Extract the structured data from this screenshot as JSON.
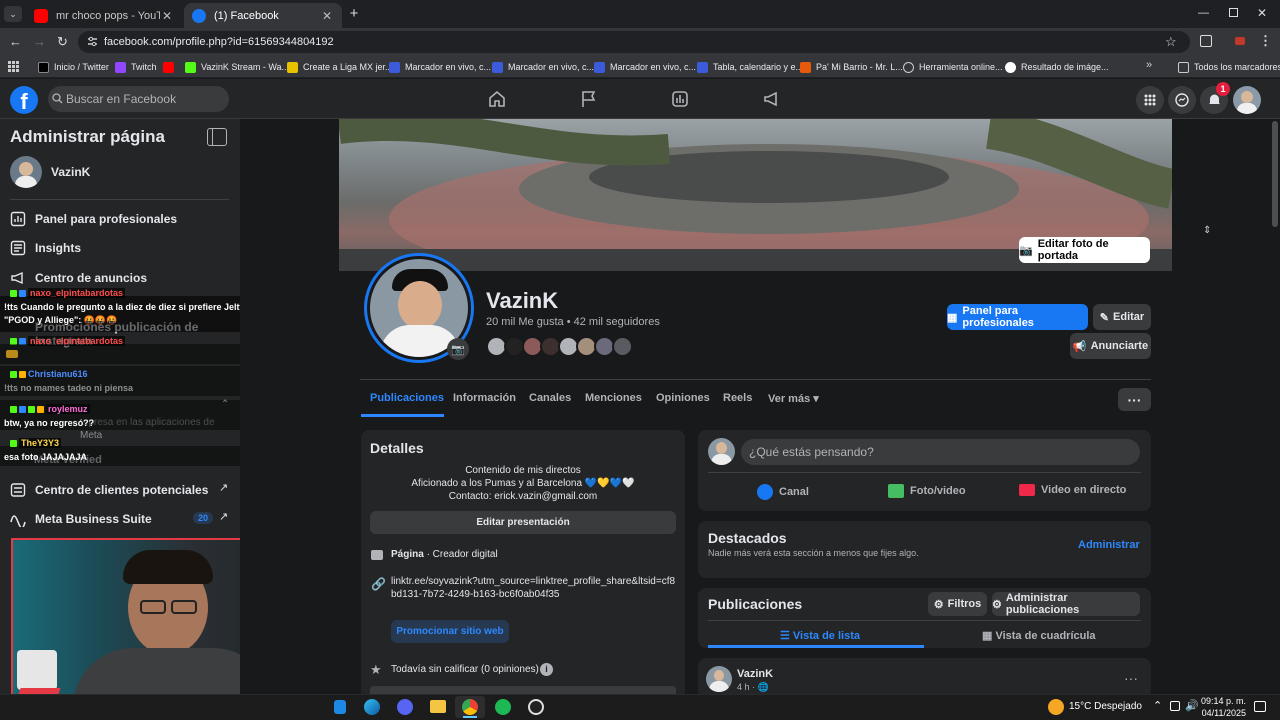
{
  "browser": {
    "tabs": [
      {
        "title": "mr choco pops - YouTube",
        "active": false
      },
      {
        "title": "(1) Facebook",
        "active": true
      }
    ],
    "url": "facebook.com/profile.php?id=61569344804192",
    "bookmarks": [
      "Inicio / Twitter",
      "Twitch",
      "",
      "VazinK Stream - Wa...",
      "Create a Liga MX jer...",
      "Marcador en vivo, c...",
      "Marcador en vivo, c...",
      "Marcador en vivo, c...",
      "Tabla, calendario y e...",
      "Pa' Mi Barrio - Mr. L...",
      "Herramienta online...",
      "Resultado de imáge..."
    ],
    "all_bookmarks": "Todos los marcadores"
  },
  "fb": {
    "search_placeholder": "Buscar en Facebook",
    "notification_count": "1"
  },
  "sidebar": {
    "title": "Administrar página",
    "page_name": "VazinK",
    "items": [
      {
        "label": "Panel para profesionales",
        "icon": "dashboard-icon"
      },
      {
        "label": "Insights",
        "icon": "insights-icon"
      },
      {
        "label": "Centro de anuncios",
        "icon": "megaphone-icon"
      },
      {
        "label": "Promociones publicación de Instagram",
        "icon": "promote-icon"
      },
      {
        "label": "...ón",
        "icon": "settings-icon"
      },
      {
        "label": "...as",
        "icon": "tools-icon"
      },
      {
        "label": "...presa en las aplicaciones de Meta",
        "icon": "app-icon"
      },
      {
        "label": "Meta Verified",
        "icon": "verified-icon"
      }
    ],
    "leads_label": "Centro de clientes potenciales",
    "business_label": "Meta Business Suite",
    "business_badge": "20"
  },
  "chat": [
    {
      "user": "naxo_elpintabardotas",
      "color": "#ff4d4d",
      "message": "!tts Cuando le pregunto a la diez de diez si prefiere Jelty o Lonche y me dice",
      "message2": "\"PGOD y Alliege\": 🤬🤬🤬"
    },
    {
      "user": "naxo_elpintabardotas",
      "color": "#ff4d4d",
      "message": "!tts no mames tadeo ni piensa"
    },
    {
      "user": "Christianu616",
      "color": "#4d8dff",
      "message": ""
    },
    {
      "user": "roylemuz",
      "color": "#ff6bd6",
      "message": "btw, ya no regresó??"
    },
    {
      "user": "TheY3Y3",
      "color": "#ffd84d",
      "message": "esa foto JAJAJAJA"
    }
  ],
  "profile": {
    "edit_cover": "Editar foto de portada",
    "name": "VazinK",
    "stats": "20 mil Me gusta • 42 mil seguidores",
    "btn_dashboard": "Panel para profesionales",
    "btn_edit": "Editar",
    "btn_advertise": "Anunciarte",
    "tabs": [
      "Publicaciones",
      "Información",
      "Canales",
      "Menciones",
      "Opiniones",
      "Reels",
      "Ver más"
    ]
  },
  "details": {
    "title": "Detalles",
    "bio1": "Contenido de mis directos",
    "bio2": "Aficionado a los Pumas y al Barcelona 💙💛💙🤍",
    "bio3": "Contacto: erick.vazin@gmail.com",
    "edit_bio": "Editar presentación",
    "page_type_bold": "Página",
    "page_type": " · Creador digital",
    "link": "linktr.ee/soyvazink?utm_source=linktree_profile_share&ltsid=cf8bd131-7b72-4249-b163-bc6f0ab04f35",
    "promote_site": "Promocionar sitio web",
    "rating": "Todavía sin calificar (0 opiniones)"
  },
  "composer": {
    "placeholder": "¿Qué estás pensando?",
    "channel": "Canal",
    "photo": "Foto/video",
    "live": "Video en directo"
  },
  "featured": {
    "title": "Destacados",
    "subtitle": "Nadie más verá esta sección a menos que fijes algo.",
    "manage": "Administrar"
  },
  "posts": {
    "title": "Publicaciones",
    "filters": "Filtros",
    "manage": "Administrar publicaciones",
    "list_view": "Vista de lista",
    "grid_view": "Vista de cuadrícula",
    "author": "VazinK",
    "time": "4 h · "
  },
  "taskbar": {
    "temp": "15°C",
    "weather": "Despejado",
    "time": "09:14 p. m.",
    "date": "04/11/2025"
  }
}
